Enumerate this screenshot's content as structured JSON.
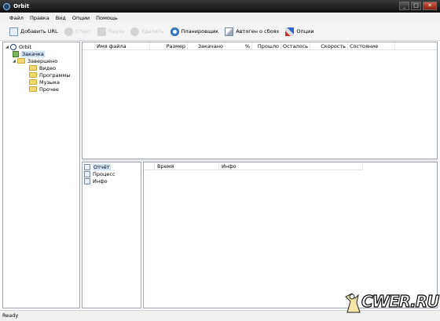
{
  "window": {
    "title": "Orbit"
  },
  "menu": [
    "Файл",
    "Правка",
    "Вид",
    "Опции",
    "Помощь"
  ],
  "toolbar": {
    "add_url": "Добавить URL",
    "start": "Старт",
    "pause": "Пауза",
    "delete": "Удалить",
    "scheduler": "Планировщик",
    "autosync": "Автоген о сбоях",
    "options": "Опции"
  },
  "tree": {
    "root": "Orbit",
    "downloading": "Закачка",
    "finished": "Завершено",
    "video": "Видео",
    "programs": "Программы",
    "music": "Музыка",
    "other": "Прочее"
  },
  "columns": [
    "Имя файла",
    "Размер",
    "Закачано",
    "%",
    "Прошло",
    "Осталось",
    "Скорость",
    "Состояние"
  ],
  "log_list": [
    "Отчёт",
    "Процесс",
    "Инфо"
  ],
  "details_columns": [
    "Время",
    "Инфо"
  ],
  "status": "Ready",
  "watermark": "CWER.RU"
}
